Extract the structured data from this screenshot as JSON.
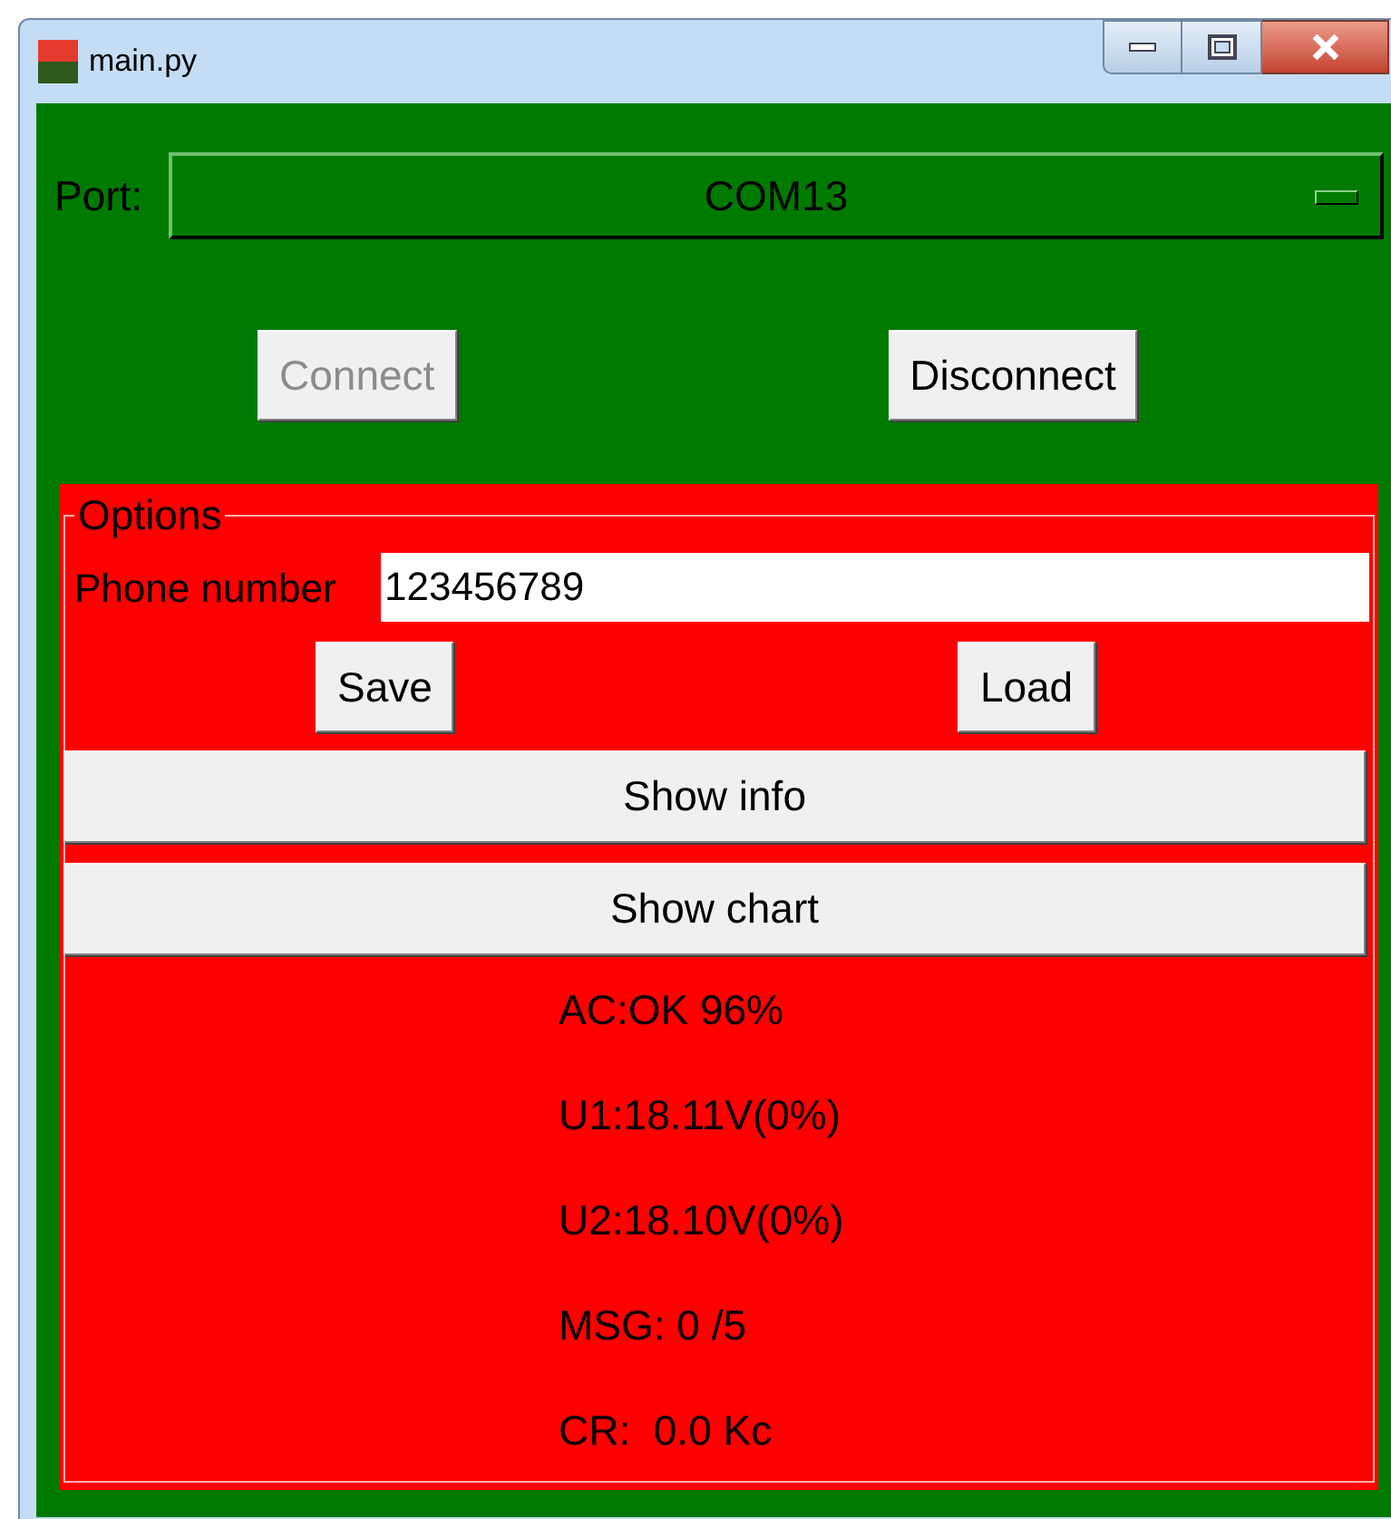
{
  "window": {
    "title": "main.py"
  },
  "port": {
    "label": "Port:",
    "value": "COM13"
  },
  "buttons": [
    {
      "label": "Connect",
      "disabled": true
    },
    {
      "label": "Disconnect",
      "disabled": false
    }
  ],
  "options": {
    "legend": "Options",
    "phone": {
      "label": "Phone number",
      "value": "123456789"
    },
    "buttons": [
      "Save",
      "Load"
    ],
    "wide_buttons": [
      "Show info",
      "Show chart"
    ],
    "status": [
      "AC:OK 96%",
      "U1:18.11V(0%)",
      "U2:18.10V(0%)",
      "MSG: 0 /5",
      "CR:  0.0 Kc"
    ]
  }
}
